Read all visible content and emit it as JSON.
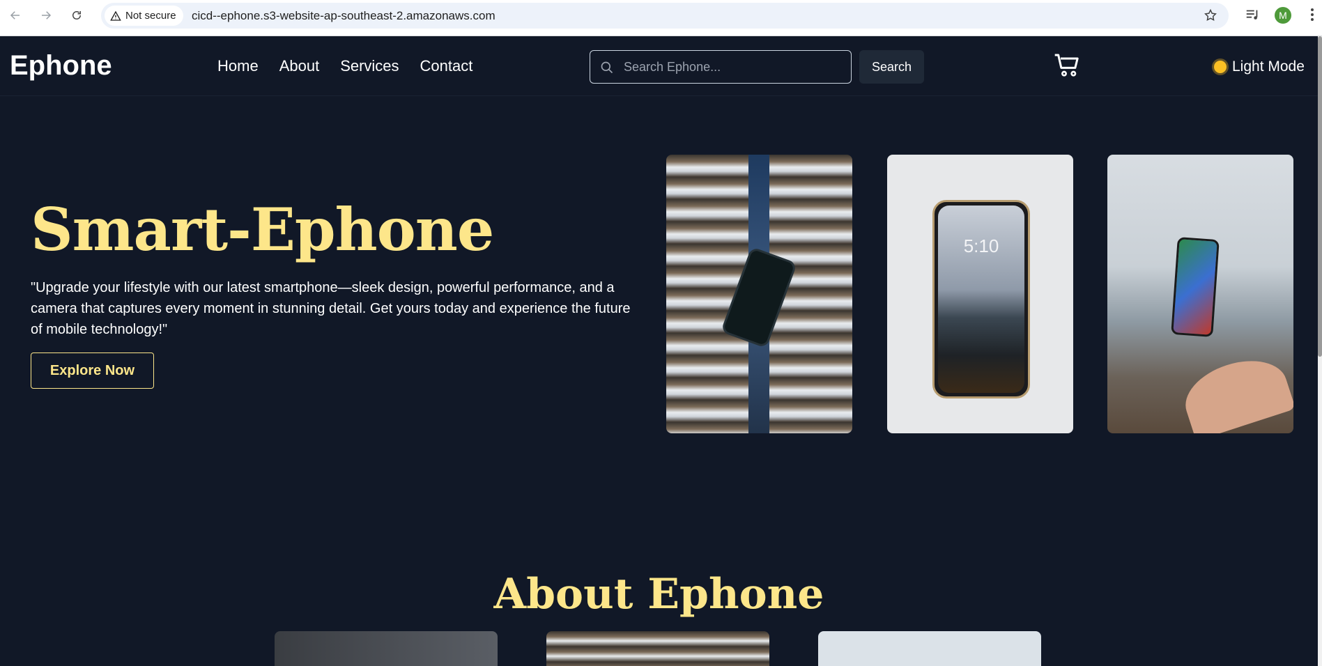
{
  "browser": {
    "security_label": "Not secure",
    "url": "cicd--ephone.s3-website-ap-southeast-2.amazonaws.com",
    "profile_initial": "M"
  },
  "header": {
    "logo": "Ephone",
    "nav": [
      "Home",
      "About",
      "Services",
      "Contact"
    ],
    "search_placeholder": "Search Ephone...",
    "search_button": "Search",
    "mode_label": "Light Mode"
  },
  "hero": {
    "title": "Smart-Ephone",
    "text": "\"Upgrade your lifestyle with our latest smartphone—sleek design, powerful performance, and a camera that captures every moment in stunning detail. Get yours today and experience the future of mobile technology!\"",
    "cta": "Explore Now",
    "phone_time": "5:10"
  },
  "about": {
    "title": "About Ephone"
  },
  "colors": {
    "background": "#111827",
    "accent": "#fde68a"
  }
}
